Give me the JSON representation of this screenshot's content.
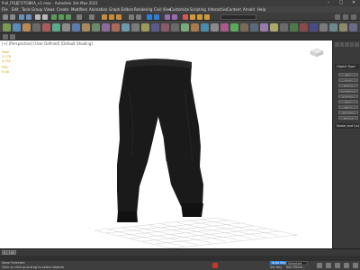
{
  "titlebar": {
    "title": "Pull_ПОДГОТОВКА_v1.max - Autodesk 3ds Max 2021",
    "minimize": "–",
    "maximize": "□",
    "close": "✕"
  },
  "menubar": {
    "items": [
      "File",
      "Edit",
      "Tools",
      "Group",
      "Views",
      "Create",
      "Modifiers",
      "Animation",
      "Graph Editors",
      "Rendering",
      "Civil View",
      "Customize",
      "Scripting",
      "Interactive",
      "Content",
      "Arnold",
      "Help"
    ]
  },
  "viewport": {
    "label": "[+] [Perspective] [User Defined] [Default Shading] ",
    "stats": [
      "Total",
      "2,178",
      "4,352",
      "FPS:",
      "9.08"
    ]
  },
  "cmdpanel": {
    "object_type": "Object Type",
    "buttons": [
      "Box",
      "Cone",
      "Sphere",
      "GeoSphere",
      "Cylinder",
      "Tube",
      "Torus",
      "Pyramid",
      "Teapot"
    ],
    "name_color": "Name and Color"
  },
  "timeline": {
    "frame": "0 / 100"
  },
  "statusbar": {
    "selection": "None Selected",
    "prompt": "Click or click-and-drag to select objects",
    "auto_key": "Auto Key",
    "selected": "Selected",
    "set_key": "Set Key",
    "key_filters": "Key Filters..."
  },
  "colors": {
    "ui_dark": "#2b2b2b",
    "viewport_bg": "#ffffff",
    "model": "#1a1a1a",
    "accent_blue": "#2d7fd8",
    "stat_yellow": "#c9a000"
  }
}
